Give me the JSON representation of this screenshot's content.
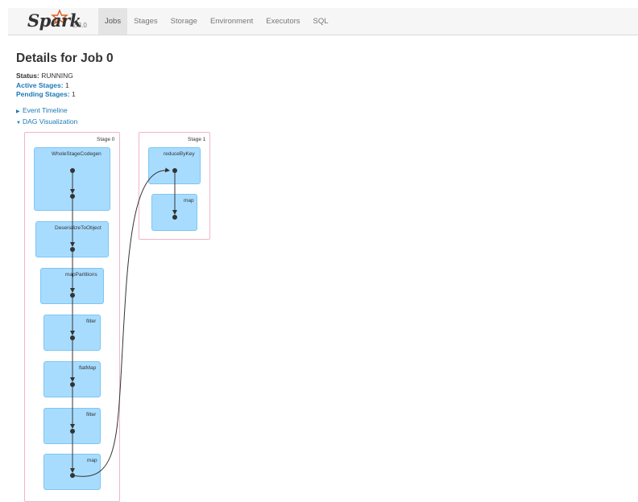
{
  "brand": {
    "name": "Spark",
    "version": "2.3.0"
  },
  "nav": {
    "tabs": [
      {
        "label": "Jobs",
        "active": true
      },
      {
        "label": "Stages"
      },
      {
        "label": "Storage"
      },
      {
        "label": "Environment"
      },
      {
        "label": "Executors"
      },
      {
        "label": "SQL"
      }
    ]
  },
  "page": {
    "title": "Details for Job 0"
  },
  "summary": {
    "status_label": "Status:",
    "status_value": "RUNNING",
    "active_label": "Active Stages:",
    "active_value": "1",
    "pending_label": "Pending Stages:",
    "pending_value": "1"
  },
  "toggles": {
    "event_timeline": "Event Timeline",
    "dag_visualization": "DAG Visualization"
  },
  "dag": {
    "stages": [
      {
        "label": "Stage 0",
        "ops": [
          "WholeStageCodegen",
          "DeserializeToObject",
          "mapPartitions",
          "filter",
          "flatMap",
          "filter",
          "map"
        ]
      },
      {
        "label": "Stage 1",
        "ops": [
          "reduceByKey",
          "map"
        ]
      }
    ]
  },
  "colors": {
    "stage_border": "#f2b6c2",
    "op_fill": "#a8dcff",
    "link": "#1c79b8"
  }
}
